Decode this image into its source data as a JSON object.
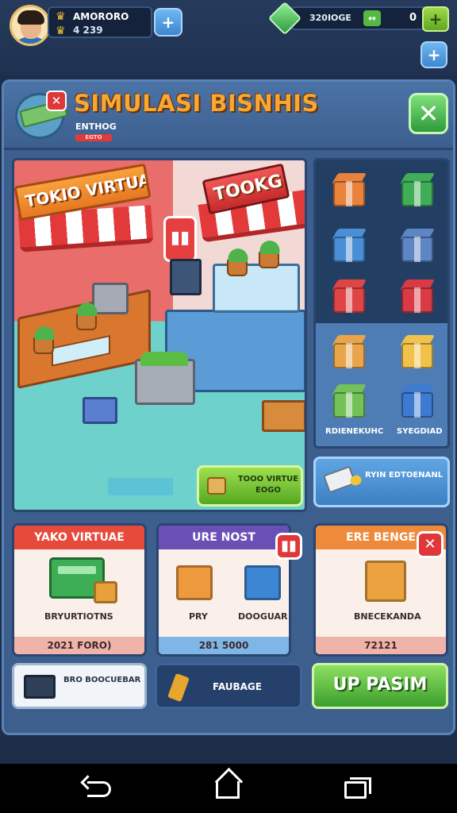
{
  "hud": {
    "player_name": "AMORORO",
    "player_level": "4 239",
    "currency_value": "320IOGE",
    "currency_count": "0",
    "plus_symbol": "+",
    "arrow_symbol": "↔"
  },
  "title": {
    "text": "SIMULASI BISNHIS",
    "subtitle": "ENTHOG",
    "badge": "EGTO",
    "close_symbol": "✕"
  },
  "scene": {
    "sign_left": "TOKIO VIRTUAL",
    "sign_right": "TOOKG",
    "button_label": "TOOO VIRTUE EOGO"
  },
  "inventory": {
    "items": [
      {
        "icon": "orange-gift-box-icon",
        "color": "#e9823a"
      },
      {
        "icon": "green-gift-box-icon",
        "color": "#3fae57"
      },
      {
        "icon": "blue-gift-box-icon",
        "color": "#4a8fd6"
      },
      {
        "icon": "blue-grid-box-icon",
        "color": "#5e86c4"
      },
      {
        "icon": "red-gift-box-icon",
        "color": "#e04545"
      },
      {
        "icon": "red-chest-icon",
        "color": "#d93b45"
      },
      {
        "icon": "cardboard-box-icon",
        "color": "#e8a54a"
      },
      {
        "icon": "gold-box-icon",
        "color": "#f1c24a"
      },
      {
        "icon": "green-crate-icon",
        "color": "#73c257"
      },
      {
        "icon": "blue-clock-box-icon",
        "color": "#3d7bd1"
      }
    ],
    "caption_left": "RDIENEKUHC",
    "caption_right": "SYEGDIAD",
    "promo_label": "RYIN EDTOENANL"
  },
  "cards": [
    {
      "title": "YAKO VIRTUAE",
      "caption": "BRYURTIOTNS",
      "footer": "2021 FORO)"
    },
    {
      "title": "URE NOST",
      "caption_left": "PRY",
      "caption_right": "DOOGUAR",
      "footer": "281 5000"
    },
    {
      "title": "ERE BENGE",
      "caption": "BNECEKANDA",
      "footer": "72121"
    }
  ],
  "card_badge_symbol": "▮▮",
  "card_close_symbol": "✕",
  "buttons": {
    "b1_label": "BRO BOOCUEBAR",
    "b2_label": "FAUBAGE",
    "b3_label": "UP PASIM"
  }
}
